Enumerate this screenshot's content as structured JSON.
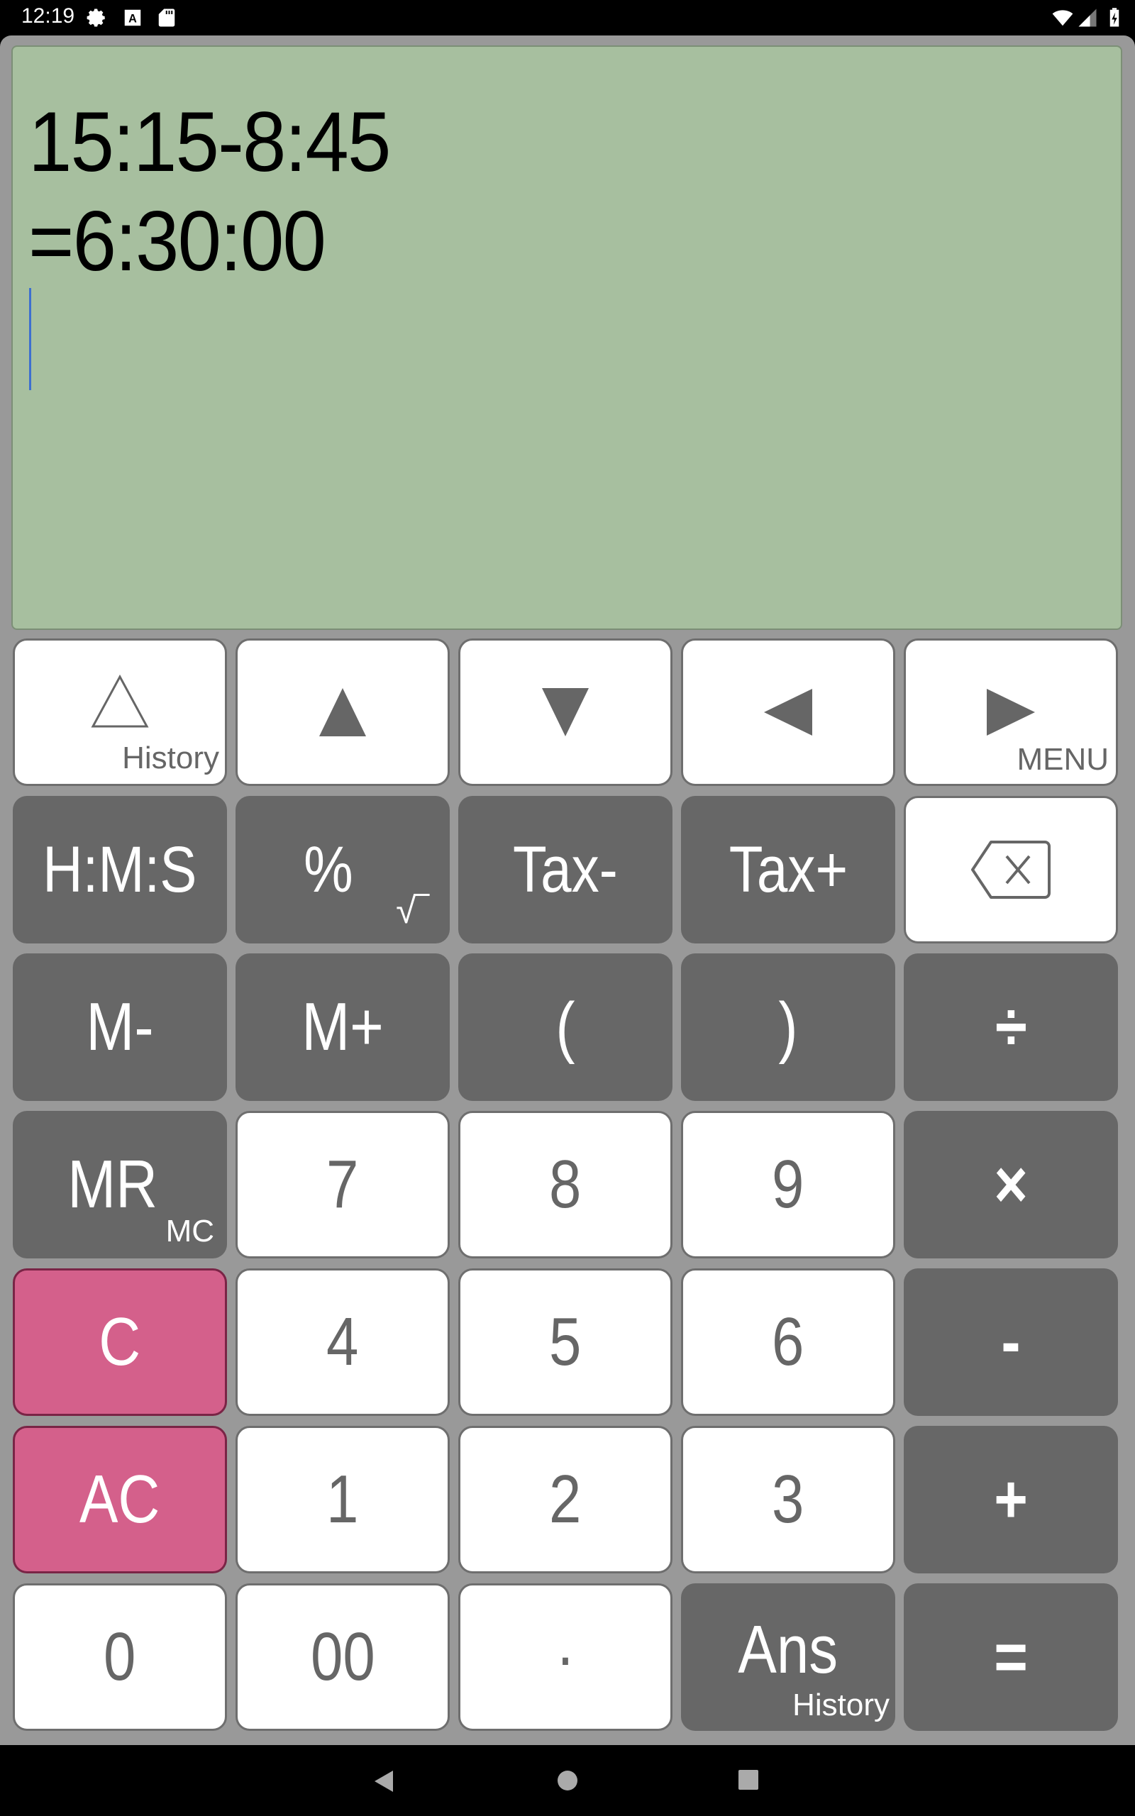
{
  "status_bar": {
    "time": "12:19",
    "left_icons": [
      "settings-icon",
      "keyboard-a-icon",
      "sd-card-icon"
    ],
    "right_icons": [
      "wifi-icon",
      "cell-signal-icon",
      "battery-charging-icon"
    ]
  },
  "display": {
    "expression": "15:15-8:45",
    "result": "=6:30:00",
    "background_color": "#a7bf9f"
  },
  "keys": {
    "history_sub": "History",
    "menu_sub": "MENU",
    "hms": "H:M:S",
    "percent": "%",
    "sqrt_sub": "√‾",
    "tax_minus": "Tax-",
    "tax_plus": "Tax+",
    "m_minus": "M-",
    "m_plus": "M+",
    "paren_open": "(",
    "paren_close": ")",
    "divide": "÷",
    "mr": "MR",
    "mc_sub": "MC",
    "seven": "7",
    "eight": "8",
    "nine": "9",
    "multiply": "×",
    "clear": "C",
    "four": "4",
    "five": "5",
    "six": "6",
    "minus": "-",
    "all_clear": "AC",
    "one": "1",
    "two": "2",
    "three": "3",
    "plus": "+",
    "zero": "0",
    "double_zero": "00",
    "decimal": "·",
    "ans": "Ans",
    "ans_history_sub": "History",
    "equals": "="
  },
  "colors": {
    "key_white": "#ffffff",
    "key_dark": "#676767",
    "key_pink": "#d4608b",
    "frame": "#999999"
  },
  "nav_bar": {
    "buttons": [
      "back-icon",
      "home-icon",
      "recents-icon"
    ]
  }
}
